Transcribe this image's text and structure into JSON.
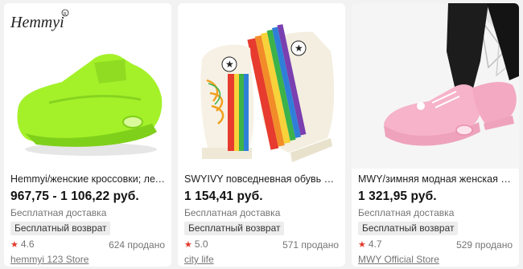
{
  "products": [
    {
      "brand_logo": "Hemmyi",
      "title": "Hemmyi/женские кроссовки; лет…",
      "price": "967,75 - 1 106,22 руб.",
      "shipping": "Бесплатная доставка",
      "return_badge": "Бесплатный возврат",
      "rating": "4.6",
      "sold": "624 продано",
      "store": "hemmyi 123 Store",
      "shoe_color": "#a4f12a"
    },
    {
      "title": "SWYIVY повседневная обувь с ра…",
      "price": "1 154,41 руб.",
      "shipping": "Бесплатная доставка",
      "return_badge": "Бесплатный возврат",
      "rating": "5.0",
      "sold": "571 продано",
      "store": "city life",
      "shoe_color": "#f3eedf"
    },
    {
      "title": "MWY/зимняя модная женская по…",
      "price": "1 321,95 руб.",
      "shipping": "Бесплатная доставка",
      "return_badge": "Бесплатный возврат",
      "rating": "4.7",
      "sold": "529 продано",
      "store": "MWY Official Store",
      "shoe_color": "#f6b3c9"
    }
  ],
  "colors": {
    "star": "#e23a2c",
    "badge_bg": "#ededed",
    "muted_text": "#757575"
  }
}
